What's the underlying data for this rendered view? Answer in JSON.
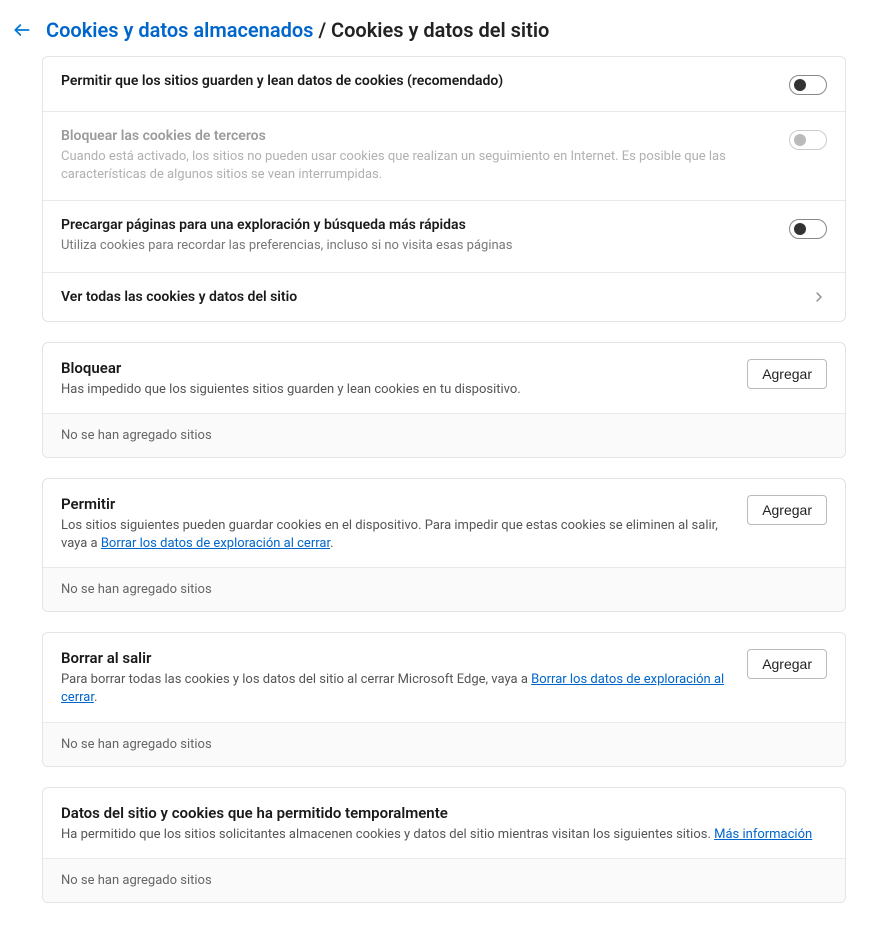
{
  "header": {
    "breadcrumb_link": "Cookies y datos almacenados",
    "breadcrumb_sep": "/",
    "breadcrumb_current": "Cookies y datos del sitio"
  },
  "settings": {
    "allow_cookies": {
      "title": "Permitir que los sitios guarden y lean datos de cookies (recomendado)",
      "on": false
    },
    "block_third_party": {
      "title": "Bloquear las cookies de terceros",
      "desc": "Cuando está activado, los sitios no pueden usar cookies que realizan un seguimiento en Internet. Es posible que las características de algunos sitios se vean interrumpidas.",
      "on": false,
      "disabled": true
    },
    "preload": {
      "title": "Precargar páginas para una exploración y búsqueda más rápidas",
      "desc": "Utiliza cookies para recordar las preferencias, incluso si no visita esas páginas",
      "on": false
    },
    "see_all": {
      "title": "Ver todas las cookies y datos del sitio"
    }
  },
  "sections": {
    "block": {
      "title": "Bloquear",
      "desc": "Has impedido que los siguientes sitios guarden y lean cookies en tu dispositivo.",
      "add_label": "Agregar",
      "empty": "No se han agregado sitios"
    },
    "allow": {
      "title": "Permitir",
      "desc_prefix": "Los sitios siguientes pueden guardar cookies en el dispositivo. Para impedir que estas cookies se eliminen al salir, vaya a ",
      "desc_link": "Borrar los datos de exploración al cerrar",
      "desc_suffix": ".",
      "add_label": "Agregar",
      "empty": "No se han agregado sitios"
    },
    "clear_on_exit": {
      "title": "Borrar al salir",
      "desc_prefix": "Para borrar todas las cookies y los datos del sitio al cerrar Microsoft Edge, vaya a ",
      "desc_link": "Borrar los datos de exploración al cerrar",
      "desc_suffix": ".",
      "add_label": "Agregar",
      "empty": "No se han agregado sitios"
    },
    "temp_allowed": {
      "title": "Datos del sitio y cookies que ha permitido temporalmente",
      "desc_prefix": "Ha permitido que los sitios solicitantes almacenen cookies y datos del sitio mientras visitan los siguientes sitios. ",
      "desc_link": "Más información",
      "desc_suffix": "",
      "empty": "No se han agregado sitios"
    }
  }
}
